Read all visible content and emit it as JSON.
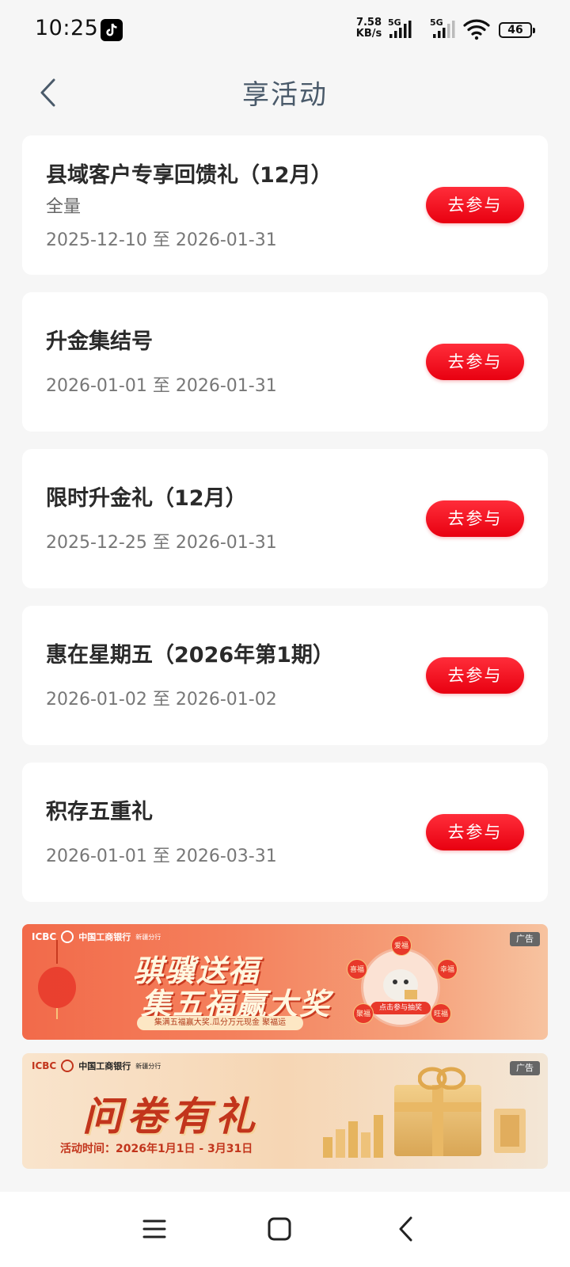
{
  "status_bar": {
    "time": "10:25",
    "net_speed_value": "7.58",
    "net_speed_unit": "KB/s",
    "signal1_label": "5G",
    "signal2_label": "5G",
    "battery": "46"
  },
  "header": {
    "title": "享活动",
    "back_icon": "chevron-left-icon"
  },
  "activities": [
    {
      "title": "县域客户专享回馈礼（12月）",
      "subtitle": "全量",
      "date_range": "2025-12-10 至 2026-01-31",
      "button_label": "去参与"
    },
    {
      "title": "升金集结号",
      "subtitle": "",
      "date_range": "2026-01-01 至 2026-01-31",
      "button_label": "去参与"
    },
    {
      "title": "限时升金礼（12月）",
      "subtitle": "",
      "date_range": "2025-12-25 至 2026-01-31",
      "button_label": "去参与"
    },
    {
      "title": "惠在星期五（2026年第1期）",
      "subtitle": "",
      "date_range": "2026-01-02 至 2026-01-02",
      "button_label": "去参与"
    },
    {
      "title": "积存五重礼",
      "subtitle": "",
      "date_range": "2026-01-01 至 2026-03-31",
      "button_label": "去参与"
    }
  ],
  "banners": [
    {
      "logo_text": "ICBC",
      "bank_name": "中国工商银行",
      "branch": "新疆分行",
      "ad_label": "广告",
      "headline_line1": "骐骥送福",
      "headline_line2": "集五福赢大奖",
      "tagline": "集满五福赢大奖.瓜分万元现金 聚福运",
      "cta": "点击参与抽奖",
      "fu_tokens": [
        "爱福",
        "喜福",
        "幸福",
        "聚福",
        "旺福"
      ]
    },
    {
      "logo_text": "ICBC",
      "bank_name": "中国工商银行",
      "branch": "新疆分行",
      "ad_label": "广告",
      "headline": "问卷有礼",
      "time_text": "活动时间：2026年1月1日 - 3月31日"
    }
  ],
  "colors": {
    "accent_red": "#e80010",
    "title_color": "#4a5a6a",
    "background": "#f6f6f6"
  },
  "nav_bar": {
    "menu_icon": "menu-icon",
    "home_icon": "home-square-icon",
    "back_icon": "back-chevron-icon"
  }
}
